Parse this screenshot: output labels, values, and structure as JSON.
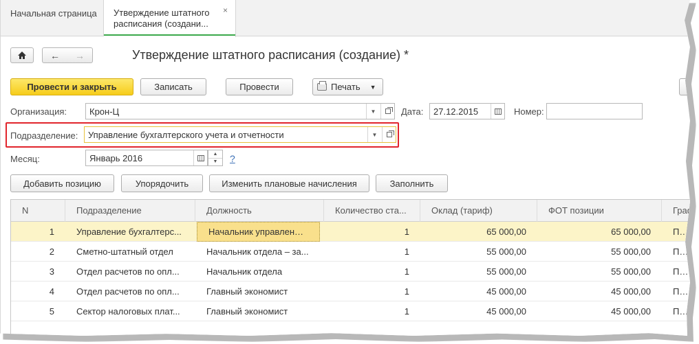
{
  "tabs": [
    {
      "label": "Начальная страница"
    },
    {
      "label_line1": "Утверждение штатного",
      "label_line2": "расписания (создани...",
      "close": "×"
    }
  ],
  "nav": {
    "home_icon": "home-icon",
    "back": "←",
    "forward": "→"
  },
  "page_title": "Утверждение штатного расписания (создание) *",
  "actions": {
    "post_close": "Провести и закрыть",
    "write": "Записать",
    "post": "Провести",
    "print": "Печать",
    "print_arrow": "▼"
  },
  "form": {
    "org_label": "Организация:",
    "org_value": "Крон-Ц",
    "date_label": "Дата:",
    "date_value": "27.12.2015",
    "number_label": "Номер:",
    "number_value": "",
    "dept_label": "Подразделение:",
    "dept_value": "Управление бухгалтерского учета и отчетности",
    "month_label": "Месяц:",
    "month_value": "Январь 2016",
    "help": "?"
  },
  "table_buttons": {
    "add": "Добавить позицию",
    "sort": "Упорядочить",
    "change": "Изменить плановые начисления",
    "fill": "Заполнить"
  },
  "table": {
    "columns": [
      "N",
      "Подразделение",
      "Должность",
      "Количество ста...",
      "Оклад (тариф)",
      "ФОТ  позиции",
      "Граф"
    ],
    "rows": [
      {
        "n": "1",
        "dept": "Управление бухгалтерс...",
        "position": "Начальник управления ...",
        "qty": "1",
        "salary": "65 000,00",
        "fot": "65 000,00",
        "sched": "Пяти"
      },
      {
        "n": "2",
        "dept": "Сметно-штатный отдел",
        "position": "Начальник отдела – за...",
        "qty": "1",
        "salary": "55 000,00",
        "fot": "55 000,00",
        "sched": "Пяти"
      },
      {
        "n": "3",
        "dept": "Отдел расчетов по опл...",
        "position": "Начальник отдела",
        "qty": "1",
        "salary": "55 000,00",
        "fot": "55 000,00",
        "sched": "Пяти"
      },
      {
        "n": "4",
        "dept": "Отдел расчетов по опл...",
        "position": "Главный экономист",
        "qty": "1",
        "salary": "45 000,00",
        "fot": "45 000,00",
        "sched": "Пяти"
      },
      {
        "n": "5",
        "dept": "Сектор налоговых плат...",
        "position": "Главный экономист",
        "qty": "1",
        "salary": "45 000,00",
        "fot": "45 000,00",
        "sched": "Пяти"
      }
    ]
  }
}
